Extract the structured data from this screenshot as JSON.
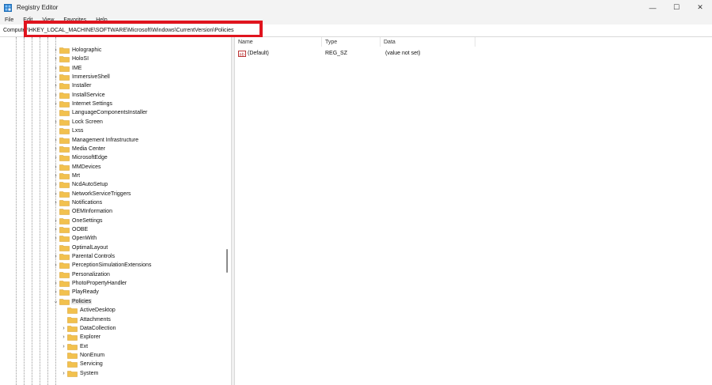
{
  "window": {
    "title": "Registry Editor",
    "controls": {
      "minimize": "—",
      "maximize": "☐",
      "close": "✕"
    }
  },
  "menu": [
    "File",
    "Edit",
    "View",
    "Favorites",
    "Help"
  ],
  "address": {
    "label": "Computer",
    "path": "\\HKEY_LOCAL_MACHINE\\SOFTWARE\\Microsoft\\Windows\\CurrentVersion\\Policies"
  },
  "tree": {
    "items": [
      {
        "label": "Holographic",
        "level": 1,
        "expander": "closed"
      },
      {
        "label": "HoloSI",
        "level": 1,
        "expander": "closed"
      },
      {
        "label": "IME",
        "level": 1,
        "expander": "closed"
      },
      {
        "label": "ImmersiveShell",
        "level": 1,
        "expander": "closed"
      },
      {
        "label": "Installer",
        "level": 1,
        "expander": "closed"
      },
      {
        "label": "InstallService",
        "level": 1,
        "expander": "closed"
      },
      {
        "label": "Internet Settings",
        "level": 1,
        "expander": "closed"
      },
      {
        "label": "LanguageComponentsInstaller",
        "level": 1,
        "expander": "none"
      },
      {
        "label": "Lock Screen",
        "level": 1,
        "expander": "closed"
      },
      {
        "label": "Lxss",
        "level": 1,
        "expander": "none"
      },
      {
        "label": "Management Infrastructure",
        "level": 1,
        "expander": "closed"
      },
      {
        "label": "Media Center",
        "level": 1,
        "expander": "closed"
      },
      {
        "label": "MicrosoftEdge",
        "level": 1,
        "expander": "closed"
      },
      {
        "label": "MMDevices",
        "level": 1,
        "expander": "closed"
      },
      {
        "label": "Mrt",
        "level": 1,
        "expander": "closed"
      },
      {
        "label": "NcdAutoSetup",
        "level": 1,
        "expander": "closed"
      },
      {
        "label": "NetworkServiceTriggers",
        "level": 1,
        "expander": "closed"
      },
      {
        "label": "Notifications",
        "level": 1,
        "expander": "closed"
      },
      {
        "label": "OEMInformation",
        "level": 1,
        "expander": "none"
      },
      {
        "label": "OneSettings",
        "level": 1,
        "expander": "closed"
      },
      {
        "label": "OOBE",
        "level": 1,
        "expander": "closed"
      },
      {
        "label": "OpenWith",
        "level": 1,
        "expander": "closed"
      },
      {
        "label": "OptimalLayout",
        "level": 1,
        "expander": "none"
      },
      {
        "label": "Parental Controls",
        "level": 1,
        "expander": "closed"
      },
      {
        "label": "PerceptionSimulationExtensions",
        "level": 1,
        "expander": "closed"
      },
      {
        "label": "Personalization",
        "level": 1,
        "expander": "none"
      },
      {
        "label": "PhotoPropertyHandler",
        "level": 1,
        "expander": "closed"
      },
      {
        "label": "PlayReady",
        "level": 1,
        "expander": "closed"
      },
      {
        "label": "Policies",
        "level": 1,
        "expander": "open",
        "selected": true
      },
      {
        "label": "ActiveDesktop",
        "level": 2,
        "expander": "none"
      },
      {
        "label": "Attachments",
        "level": 2,
        "expander": "none"
      },
      {
        "label": "DataCollection",
        "level": 2,
        "expander": "closed"
      },
      {
        "label": "Explorer",
        "level": 2,
        "expander": "closed"
      },
      {
        "label": "Ext",
        "level": 2,
        "expander": "closed"
      },
      {
        "label": "NonEnum",
        "level": 2,
        "expander": "none"
      },
      {
        "label": "Servicing",
        "level": 2,
        "expander": "none"
      },
      {
        "label": "System",
        "level": 2,
        "expander": "closed"
      }
    ]
  },
  "values": {
    "columns": [
      "Name",
      "Type",
      "Data"
    ],
    "rows": [
      {
        "name": "(Default)",
        "type": "REG_SZ",
        "data": "(value not set)"
      }
    ]
  },
  "colors": {
    "highlight_box": "#e0141e",
    "folder": "#f2c14e",
    "selection": "#e5e5e5"
  }
}
